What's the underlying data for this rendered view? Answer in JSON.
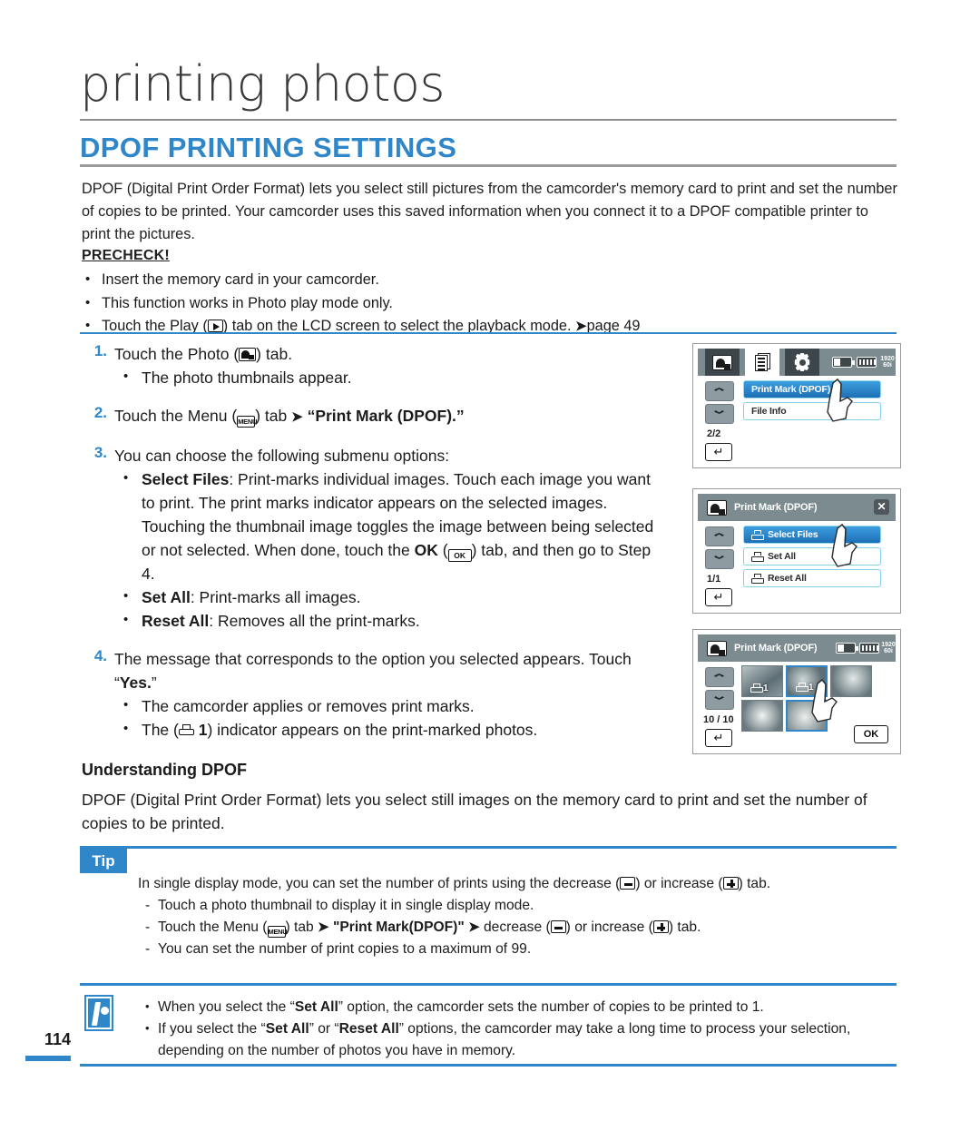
{
  "chapter": {
    "title": "printing photos"
  },
  "section": {
    "heading": "DPOF PRINTING SETTINGS"
  },
  "intro": "DPOF (Digital Print Order Format) lets you select still pictures from the camcorder's memory card to print and set the number of copies to be printed. Your camcorder uses this saved information when you connect it to a DPOF compatible printer to print the pictures.",
  "precheck": {
    "title": "PRECHECK!",
    "items": [
      "Insert the memory card in your camcorder.",
      "This function works in Photo play mode only.",
      "Touch the Play (  ) tab on the LCD screen to select the playback mode.  page 49"
    ],
    "item1": "Insert the memory card in your camcorder.",
    "item2": "This function works in Photo play mode only.",
    "item3_a": "Touch the Play (",
    "item3_b": ") tab on the LCD screen to select the playback mode.",
    "item3_page": "page 49"
  },
  "steps": {
    "s1": {
      "num": "1.",
      "a": "Touch the Photo (",
      "b": ") tab.",
      "sub1": "The photo thumbnails appear."
    },
    "s2": {
      "num": "2.",
      "a": "Touch the Menu (",
      "b": ") tab",
      "arrow": "➜",
      "c": "“Print Mark (DPOF).”"
    },
    "s3": {
      "num": "3.",
      "a": "You can choose the following submenu options:",
      "sub1_label": "Select Files",
      "sub1_text": ": Print-marks individual images. Touch each image you want to print. The print marks indicator appears on the selected images. Touching the thumbnail image toggles the image between being selected or not selected. When done, touch the ",
      "sub1_ok": "OK",
      "sub1_tail": ") tab, and then go to Step 4.",
      "sub2_label": "Set All",
      "sub2_text": ": Print-marks all images.",
      "sub3_label": "Reset All",
      "sub3_text": ": Removes all the print-marks."
    },
    "s4": {
      "num": "4.",
      "a": "The message that corresponds to the option you selected appears. Touch “",
      "yes": "Yes.",
      "a_tail": "”",
      "sub1": "The camcorder applies or removes print marks.",
      "sub2_a": "The (",
      "sub2_num": "1",
      "sub2_b": ") indicator appears on the print-marked photos."
    }
  },
  "lcd1": {
    "menu_items": [
      {
        "label": "Print Mark (DPOF)",
        "selected": true
      },
      {
        "label": "File Info",
        "selected": false
      }
    ],
    "page_indicator": "2/2",
    "icons": {
      "tab1": "photo-play-icon",
      "tab2": "menu-document-icon",
      "tab3": "settings-gear-icon",
      "battery": "battery-icon",
      "card": "memory-card-icon",
      "resolution": "1920x1080-icon"
    },
    "resolution_top": "1920",
    "resolution_bottom": "60i"
  },
  "lcd2": {
    "title": "Print Mark (DPOF)",
    "close": "✕",
    "menu_items": [
      {
        "label": "Select Files",
        "selected": true
      },
      {
        "label": "Set All",
        "selected": false
      },
      {
        "label": "Reset All",
        "selected": false
      }
    ],
    "page_indicator": "1/1"
  },
  "lcd3": {
    "title": "Print Mark (DPOF)",
    "page_indicator": "10 / 10",
    "ok_label": "OK",
    "thumbnails": [
      {
        "mark": "1",
        "marked": true,
        "selected": false,
        "tone": "#7f9096"
      },
      {
        "mark": "1",
        "marked": true,
        "selected": true,
        "tone": "#6f8188"
      },
      {
        "mark": "",
        "marked": false,
        "selected": false,
        "tone": "#8a989d"
      },
      {
        "mark": "",
        "marked": false,
        "selected": false,
        "tone": "#8e9ca0"
      },
      {
        "mark": "",
        "marked": false,
        "selected": true,
        "tone": "#a2aeb1"
      }
    ]
  },
  "understanding": {
    "heading": "Understanding DPOF",
    "text": "DPOF (Digital Print Order Format) lets you select still images on the memory card to print and set the number of copies to be printed."
  },
  "tip": {
    "label": "Tip",
    "line1_a": "In single display mode, you can set the number of prints using the decrease (",
    "line1_b": ") or increase (",
    "line1_c": ") tab.",
    "d1": "Touch a photo thumbnail to display it in single display mode.",
    "d2_a": "Touch the Menu (",
    "d2_b": ") tab",
    "d2_bold": "\"Print Mark(DPOF)\"",
    "d2_c": "decrease (",
    "d2_d": ") or increase (",
    "d2_e": ") tab.",
    "d3": "You can set the number of print copies to a maximum of 99."
  },
  "note": {
    "n1_a": "When you select the “",
    "n1_bold": "Set All",
    "n1_b": "” option, the camcorder sets the number of copies to be printed to 1.",
    "n2_a": "If you select the “",
    "n2_bold1": "Set All",
    "n2_mid": "” or “",
    "n2_bold2": "Reset All",
    "n2_b": "” options, the camcorder may take a long time to process your selection, depending on the number of photos you have in memory."
  },
  "page_number": "114",
  "colors": {
    "accent": "#2f86c8",
    "text": "#1c1c1c",
    "lcd_bar": "#7b8b90",
    "lcd_tab_dark": "#3c464b"
  }
}
